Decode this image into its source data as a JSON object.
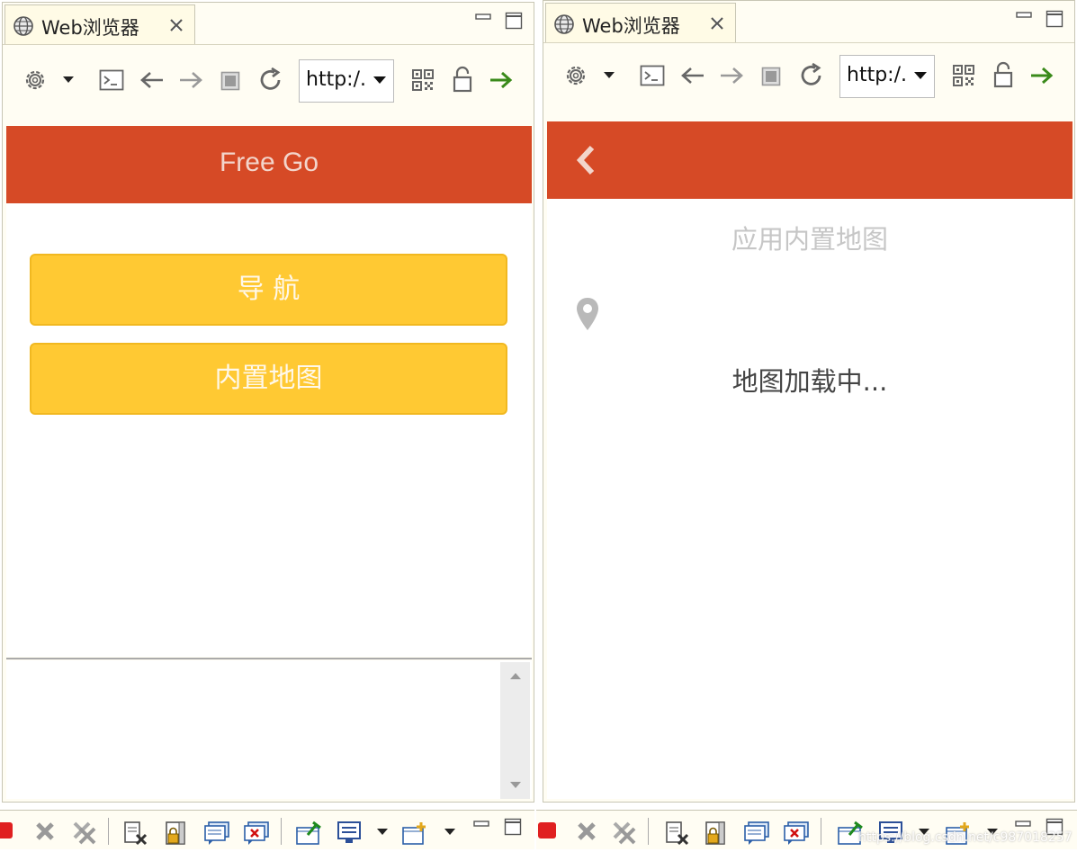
{
  "left": {
    "tab_title": "Web浏览器",
    "url_value": "http:/.",
    "header_title": "Free Go",
    "buttons": [
      {
        "label": "导 航"
      },
      {
        "label": "内置地图"
      }
    ]
  },
  "right": {
    "tab_title": "Web浏览器",
    "url_value": "http:/.",
    "page_subtitle": "应用内置地图",
    "map_loading": "地图加载中..."
  },
  "watermark": "https://blog.csdn.net/c987018257",
  "colors": {
    "header_red": "#d64a26",
    "button_yellow": "#ffc933",
    "go_arrow_green": "#3a8a1a"
  },
  "icons": [
    "globe-icon",
    "close-tab-icon",
    "minimize-icon",
    "maximize-icon",
    "settings-icon",
    "dropdown-icon",
    "console-icon",
    "back-arrow-icon",
    "forward-arrow-icon",
    "stop-icon",
    "refresh-icon",
    "qr-code-icon",
    "unlock-icon",
    "go-arrow-icon",
    "chevron-left-icon",
    "map-pin-icon"
  ]
}
